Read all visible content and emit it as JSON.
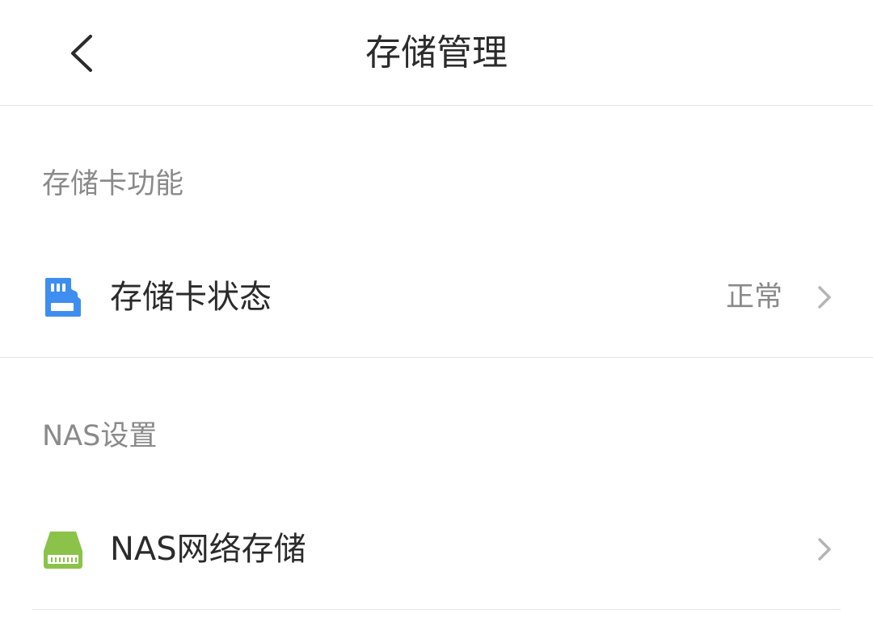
{
  "header": {
    "title": "存储管理",
    "back_icon": "chevron-left-icon"
  },
  "sections": [
    {
      "title": "存储卡功能",
      "items": [
        {
          "label": "存储卡状态",
          "value": "正常",
          "icon": "sd-card-icon",
          "icon_color": "#3e8ef0"
        }
      ]
    },
    {
      "title": "NAS设置",
      "items": [
        {
          "label": "NAS网络存储",
          "value": "",
          "icon": "nas-drive-icon",
          "icon_color": "#8bc34a"
        }
      ]
    }
  ],
  "colors": {
    "text_primary": "#2b2b2b",
    "text_secondary": "#8a8a8a",
    "divider": "#e4e4e4",
    "chevron": "#b5b5b5"
  }
}
